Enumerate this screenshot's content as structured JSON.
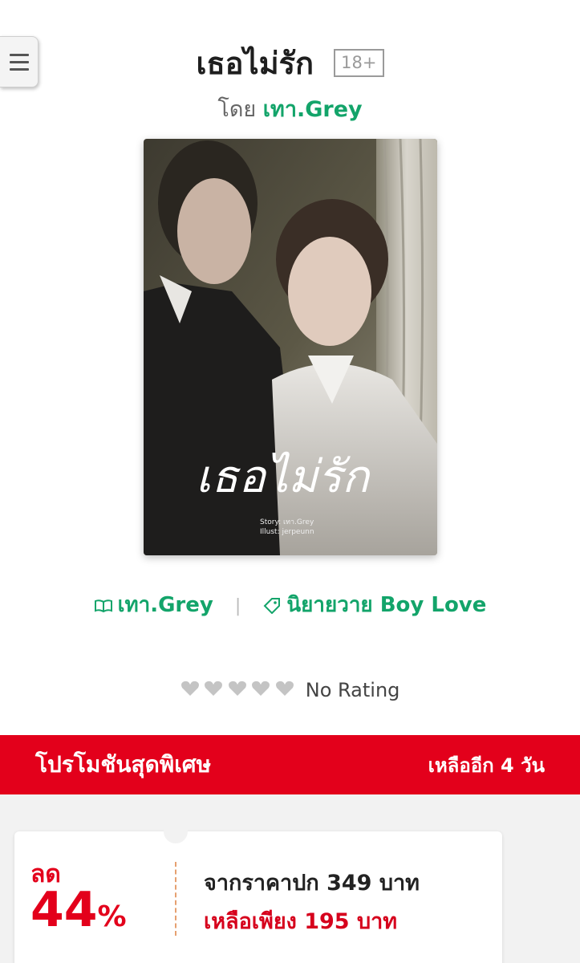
{
  "book": {
    "title": "เธอไม่รัก",
    "age_rating": "18+",
    "by_label": "โดย",
    "author": "เทา.Grey",
    "cover_title": "เธอไม่รัก",
    "cover_story": "Story: เทา.Grey",
    "cover_illust": "Illust: jerpeunn"
  },
  "meta": {
    "author_link": "เทา.Grey",
    "category_link": "นิยายวาย Boy Love",
    "book-icon": "book-icon",
    "tag-icon": "tag-icon"
  },
  "rating": {
    "hearts_filled": 0,
    "hearts_total": 5,
    "text": "No Rating"
  },
  "promo": {
    "title": "โปรโมชันสุดพิเศษ",
    "remaining": "เหลืออีก 4 วัน",
    "discount_label": "ลด",
    "discount_value": "44",
    "discount_unit": "%",
    "original_price": "จากราคาปก 349 บาท",
    "sale_price": "เหลือเพียง 195 บาท"
  },
  "colors": {
    "accent_green": "#13a46a",
    "promo_red": "#e3001b"
  }
}
